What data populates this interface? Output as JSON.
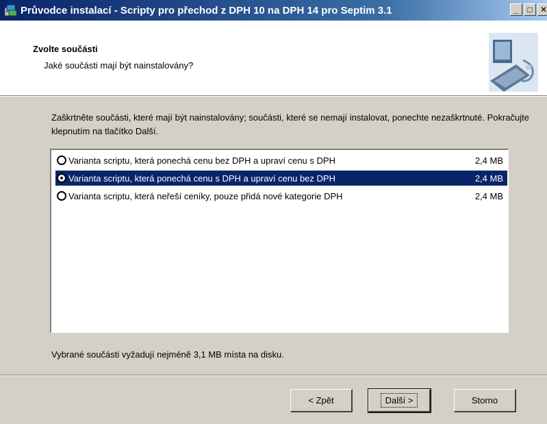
{
  "window": {
    "title": "Průvodce instalací - Scripty pro přechod z DPH 10 na DPH 14 pro Septim 3.1",
    "min_label": "_",
    "max_label": "□",
    "close_label": "✕"
  },
  "header": {
    "title": "Zvolte součásti",
    "subtitle": "Jaké součásti mají být nainstalovány?"
  },
  "description": "Zaškrtněte součásti, které mají být nainstalovány; součásti, které se nemají instalovat, ponechte nezaškrtnuté. Pokračujte klepnutím na tlačítko Další.",
  "components": [
    {
      "label": "Varianta scriptu, která ponechá cenu bez DPH a upraví cenu s DPH",
      "size": "2,4 MB",
      "checked": false,
      "selected": false
    },
    {
      "label": "Varianta scriptu, která ponechá cenu s DPH a upraví cenu bez DPH",
      "size": "2,4 MB",
      "checked": true,
      "selected": true
    },
    {
      "label": "Varianta scriptu, která neřeší ceníky, pouze přidá nové kategorie DPH",
      "size": "2,4 MB",
      "checked": false,
      "selected": false
    }
  ],
  "space_required": "Vybrané součásti vyžadují nejméně 3,1 MB místa na disku.",
  "buttons": {
    "back": "< Zpět",
    "next": "Další >",
    "cancel": "Storno"
  },
  "colors": {
    "selection": "#0a246a",
    "face": "#d4d0c8"
  }
}
